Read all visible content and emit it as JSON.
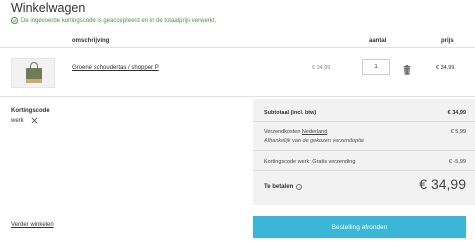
{
  "page": {
    "title": "Winkelwagen"
  },
  "notice": {
    "text": "De ingevoerde kortingscode is geaccepteerd en in de totaalprijs verwerkt."
  },
  "table": {
    "headers": {
      "description": "omschrijving",
      "quantity": "aantal",
      "price": "prijs"
    }
  },
  "item": {
    "name": "Groene schoudertas / shopper P",
    "unit_price": "€ 34,99",
    "quantity": "1",
    "price": "€ 34,99"
  },
  "discount": {
    "label": "Kortingscode",
    "code": "werk"
  },
  "summary": {
    "subtotal_label": "Subtotaal (incl. btw)",
    "subtotal_value": "€ 34,99",
    "shipping_label": "Verzendkosten",
    "shipping_country": "Nederland",
    "shipping_value": "€ 5,99",
    "shipping_note": "Afhankelijk van de gekozen verzendoptie",
    "code_label": "Kortingscode werk: Gratis verzending",
    "code_value": "€ -5,99",
    "total_label": "Te betalen",
    "total_value": "€ 34,99"
  },
  "actions": {
    "continue": "Verder winkelen",
    "checkout": "Bestelling afronden"
  },
  "colors": {
    "accent": "#3ab6d6",
    "success": "#4a9a3a",
    "summary_bg": "#f2f2f2"
  },
  "icons": [
    "check-circle-icon",
    "trash-icon",
    "close-icon",
    "info-icon"
  ]
}
